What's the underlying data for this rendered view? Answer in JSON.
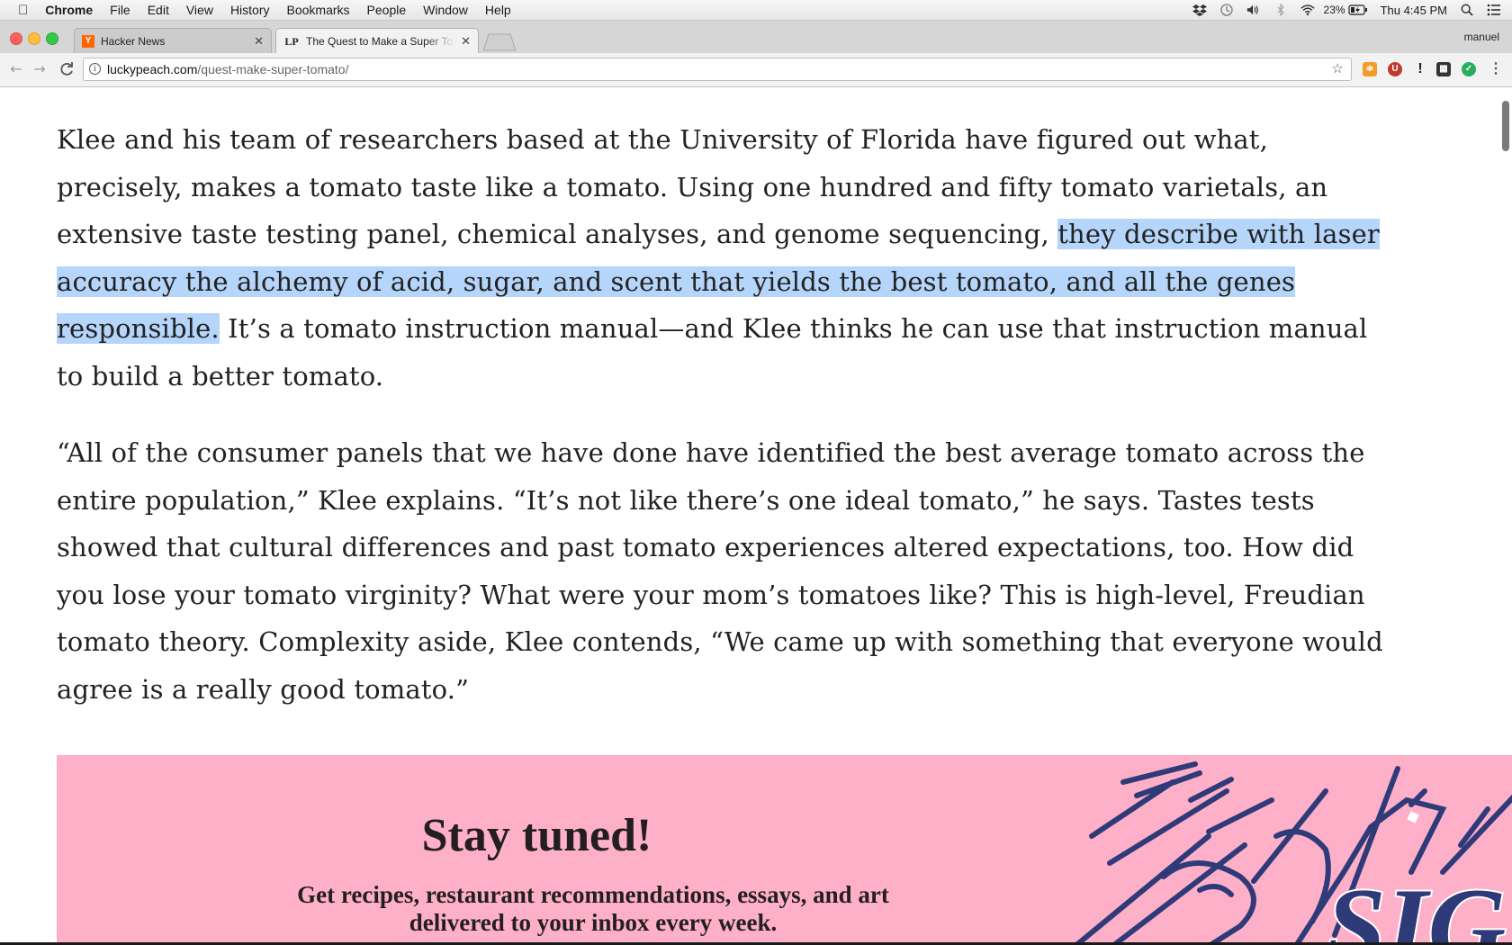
{
  "menubar": {
    "app": "Chrome",
    "items": [
      "File",
      "Edit",
      "View",
      "History",
      "Bookmarks",
      "People",
      "Window",
      "Help"
    ],
    "battery": "23%",
    "clock": "Thu 4:45 PM",
    "icons": [
      "apple-icon",
      "dropbox-icon",
      "time-machine-icon",
      "volume-icon",
      "bluetooth-icon",
      "wifi-icon",
      "battery-icon",
      "spotlight-icon",
      "notification-center-icon"
    ]
  },
  "tabs": [
    {
      "title": "Hacker News",
      "favicon": "Y",
      "favicon_color": "#ff6600",
      "active": false
    },
    {
      "title": "The Quest to Make a Super To",
      "favicon": "LP",
      "active": true
    }
  ],
  "profile_name": "manuel",
  "address": {
    "host": "luckypeach.com",
    "path": "/quest-make-super-tomato/"
  },
  "article": {
    "p1_before": "Klee and his team of researchers based at the University of Florida have figured out what, precisely, makes a tomato taste like a tomato. Using one hundred and fifty tomato varietals, an extensive taste testing panel, chemical analyses, and genome sequencing, ",
    "p1_selected": "they describe with laser accuracy the alchemy of acid, sugar, and scent that yields the best tomato, and all the genes responsible.",
    "p1_after": " It’s a tomato instruction manual—and Klee thinks he can use that instruction manual to build a better tomato.",
    "p2": "“All of the consumer panels that we have done have identified the best average tomato across the entire population,” Klee explains. “It’s not like there’s one ideal tomato,” he says. Tastes tests showed that cultural differences and past tomato experiences altered expectations, too. How did you lose your tomato virginity? What were your mom’s tomatoes like? This is high-level, Freudian tomato theory. Complexity aside, Klee contends, “We came up with something that everyone would agree is a really good tomato.”"
  },
  "newsletter": {
    "heading": "Stay tuned!",
    "sub_line1": "Get recipes, restaurant recommendations, essays, and art",
    "sub_line2": "delivered to your inbox every week.",
    "art_text": "SIG"
  },
  "colors": {
    "selection": "#b5d5fb",
    "promo_bg": "#ffb0c9",
    "promo_ink": "#2f3a78"
  }
}
